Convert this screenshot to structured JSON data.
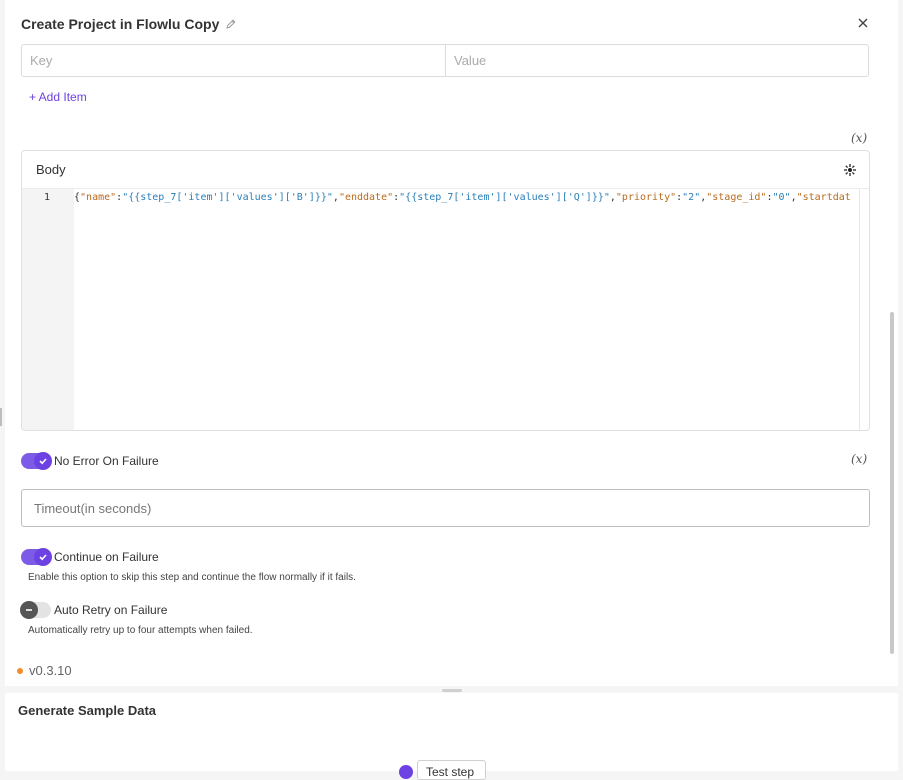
{
  "header": {
    "title": "Create Project in Flowlu Copy"
  },
  "headers_table": {
    "key_placeholder": "Key",
    "value_placeholder": "Value",
    "add_item_label": "+ Add Item"
  },
  "body": {
    "label": "Body",
    "line_number": "1",
    "code_tokens": [
      {
        "t": "p",
        "v": "{"
      },
      {
        "t": "k",
        "v": "\"name\""
      },
      {
        "t": "p",
        "v": ":"
      },
      {
        "t": "s",
        "v": "\"{{step_7['item']['values']['B']}}\""
      },
      {
        "t": "p",
        "v": ","
      },
      {
        "t": "k",
        "v": "\"enddate\""
      },
      {
        "t": "p",
        "v": ":"
      },
      {
        "t": "s",
        "v": "\"{{step_7['item']['values']['Q']}}\""
      },
      {
        "t": "p",
        "v": ","
      },
      {
        "t": "k",
        "v": "\"priority\""
      },
      {
        "t": "p",
        "v": ":"
      },
      {
        "t": "s",
        "v": "\"2\""
      },
      {
        "t": "p",
        "v": ","
      },
      {
        "t": "k",
        "v": "\"stage_id\""
      },
      {
        "t": "p",
        "v": ":"
      },
      {
        "t": "s",
        "v": "\"0\""
      },
      {
        "t": "p",
        "v": ","
      },
      {
        "t": "k",
        "v": "\"startdat"
      }
    ]
  },
  "fx_symbol": "(x)",
  "options": {
    "no_error_on_failure": {
      "label": "No Error On Failure",
      "enabled": true
    },
    "timeout": {
      "placeholder": "Timeout(in seconds)"
    },
    "continue_on_failure": {
      "label": "Continue on Failure",
      "help": "Enable this option to skip this step and continue the flow normally if it fails.",
      "enabled": true
    },
    "auto_retry": {
      "label": "Auto Retry on Failure",
      "help": "Automatically retry up to four attempts when failed.",
      "enabled": false
    }
  },
  "version": "v0.3.10",
  "sample_data": {
    "title": "Generate Sample Data",
    "test_button_label": "Test step"
  },
  "colors": {
    "accent": "#6e41e2",
    "version_dot": "#f28c28"
  }
}
